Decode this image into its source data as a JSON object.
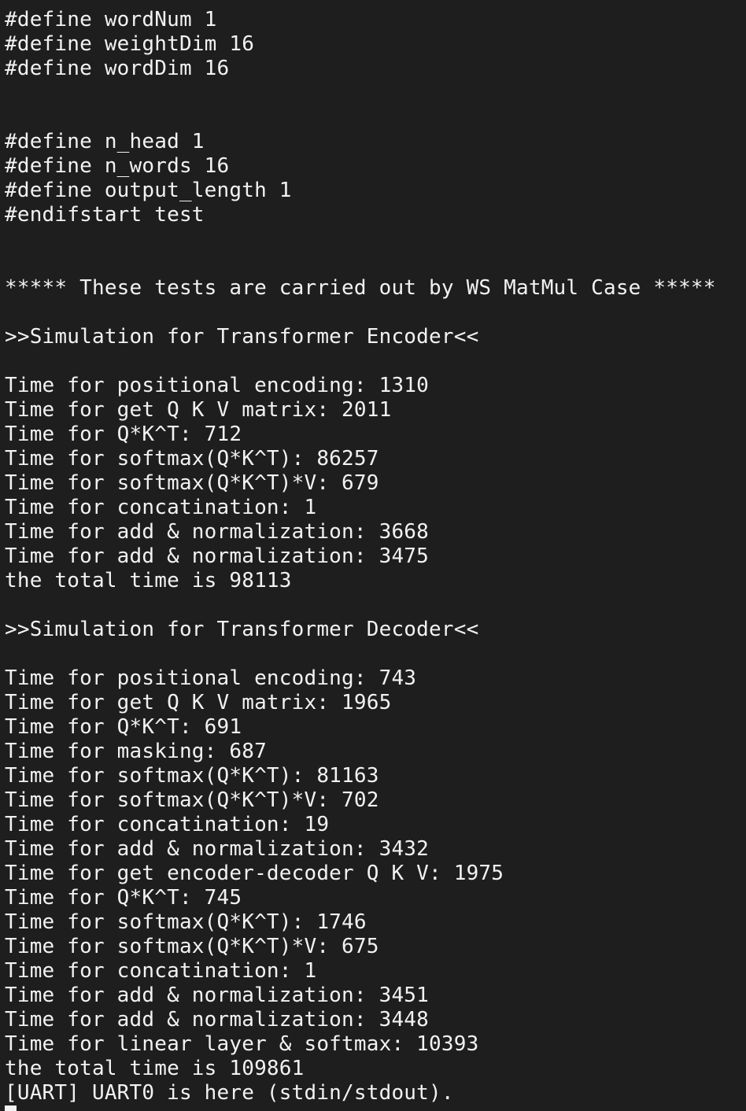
{
  "terminal": {
    "colors": {
      "background": "#1e1e1e",
      "foreground": "#f2f2f2"
    },
    "lines": [
      "#define wordNum 1",
      "#define weightDim 16",
      "#define wordDim 16",
      "",
      "",
      "#define n_head 1",
      "#define n_words 16",
      "#define output_length 1",
      "#endifstart test",
      "",
      "",
      "***** These tests are carried out by WS MatMul Case *****",
      "",
      ">>Simulation for Transformer Encoder<<",
      "",
      "Time for positional encoding: 1310",
      "Time for get Q K V matrix: 2011",
      "Time for Q*K^T: 712",
      "Time for softmax(Q*K^T): 86257",
      "Time for softmax(Q*K^T)*V: 679",
      "Time for concatination: 1",
      "Time for add & normalization: 3668",
      "Time for add & normalization: 3475",
      "the total time is 98113",
      "",
      ">>Simulation for Transformer Decoder<<",
      "",
      "Time for positional encoding: 743",
      "Time for get Q K V matrix: 1965",
      "Time for Q*K^T: 691",
      "Time for masking: 687",
      "Time for softmax(Q*K^T): 81163",
      "Time for softmax(Q*K^T)*V: 702",
      "Time for concatination: 19",
      "Time for add & normalization: 3432",
      "Time for get encoder-decoder Q K V: 1975",
      "Time for Q*K^T: 745",
      "Time for softmax(Q*K^T): 1746",
      "Time for softmax(Q*K^T)*V: 675",
      "Time for concatination: 1",
      "Time for add & normalization: 3451",
      "Time for add & normalization: 3448",
      "Time for linear layer & softmax: 10393",
      "the total time is 109861",
      "[UART] UART0 is here (stdin/stdout)."
    ]
  }
}
